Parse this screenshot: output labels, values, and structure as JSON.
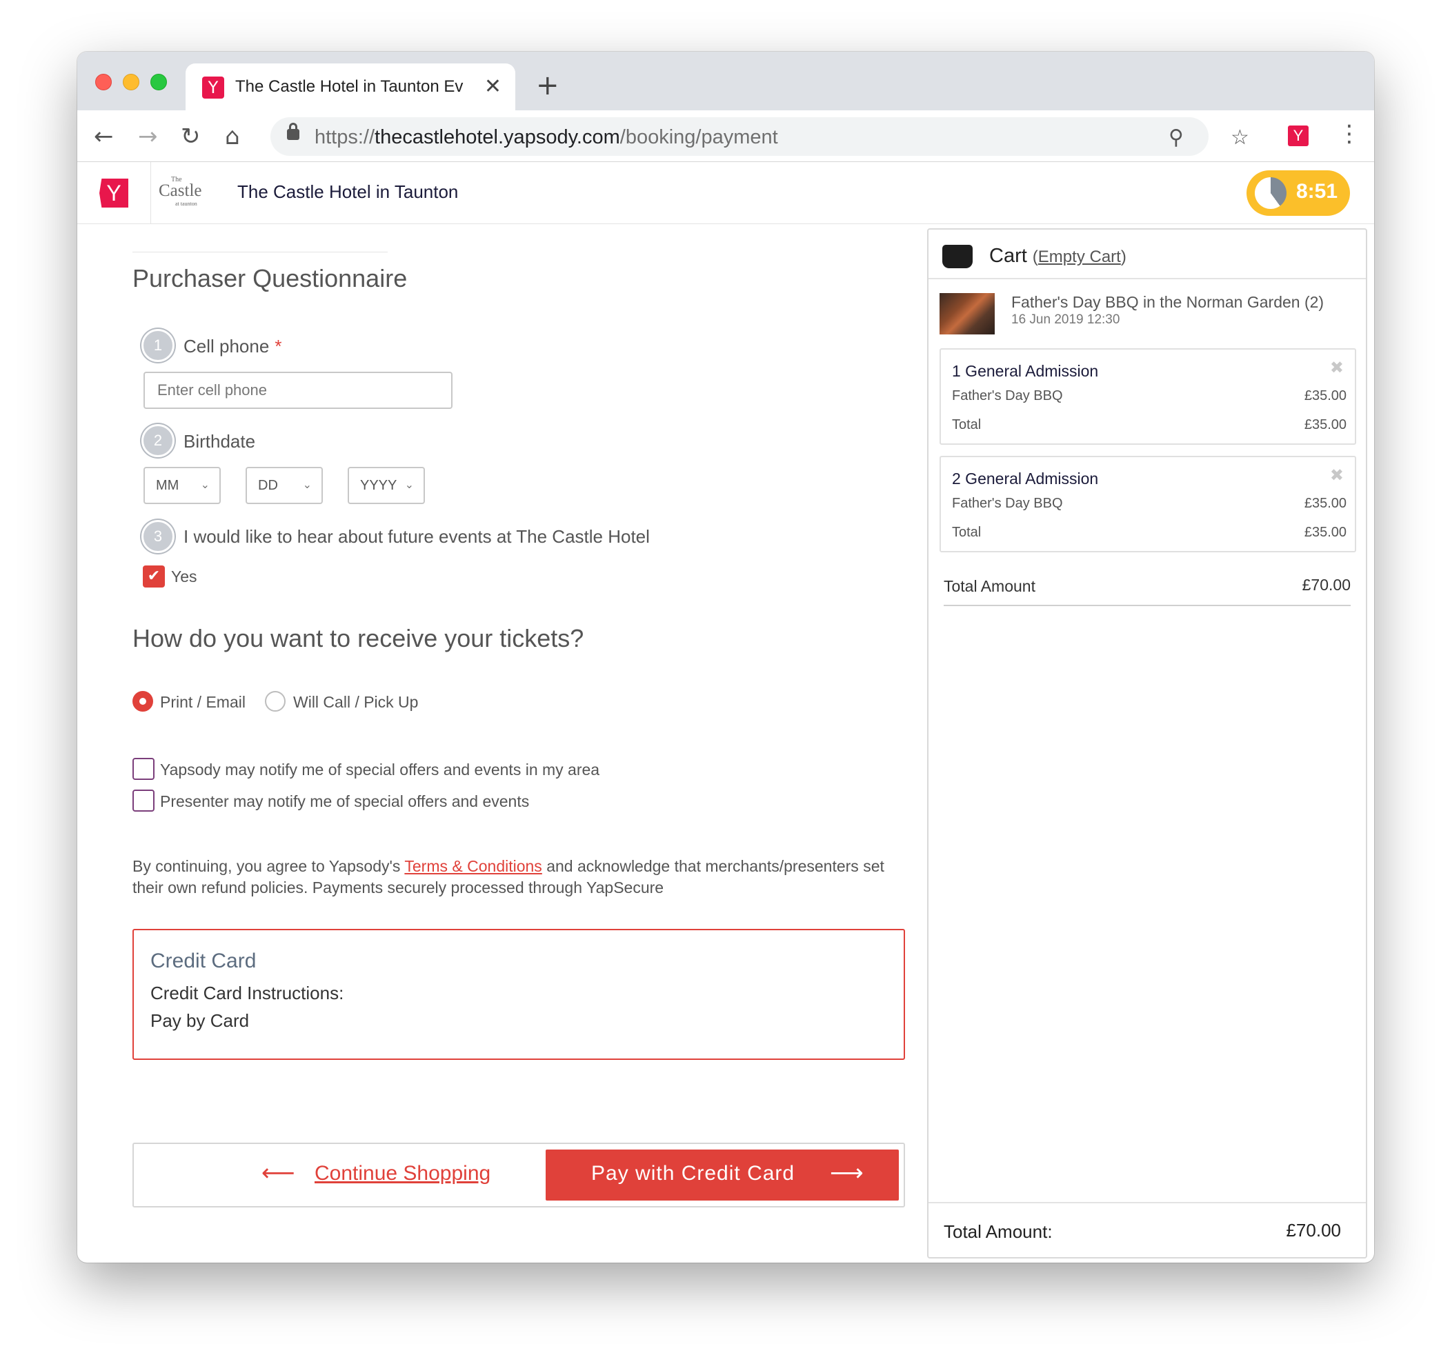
{
  "browser": {
    "tab_title": "The Castle Hotel in Taunton Ev",
    "tab_close": "✕",
    "new_tab": "+",
    "url_scheme": "https://",
    "url_host": "thecastlehotel.yapsody.com",
    "url_path": "/booking/payment",
    "back_icon": "←",
    "forward_icon": "→",
    "reload_icon": "↻",
    "home_icon": "⌂",
    "zoom_icon": "⚲",
    "star_icon": "☆",
    "menu_icon": "⋮",
    "ext_letter": "Y"
  },
  "header": {
    "brand_letter": "Y",
    "castle_small": "The",
    "castle_main": "Castle",
    "castle_sub": "at taunton",
    "venue_name": "The Castle Hotel in Taunton",
    "timer": "8:51",
    "timer_remaining_fraction": 0.6
  },
  "questionnaire": {
    "title": "Purchaser Questionnaire",
    "q1_num": "1",
    "q1_label": "Cell phone",
    "q1_required": "*",
    "q1_placeholder": "Enter cell phone",
    "q2_num": "2",
    "q2_label": "Birthdate",
    "month": "MM",
    "day": "DD",
    "year": "YYYY",
    "chevron": "⌄",
    "q3_num": "3",
    "q3_label": "I would like to hear about future events at The Castle Hotel",
    "q3_check": "✔",
    "q3_option": "Yes"
  },
  "delivery": {
    "title": "How do you want to receive your tickets?",
    "option1": "Print / Email",
    "option2": "Will Call / Pick Up",
    "selected": "Print / Email"
  },
  "consents": {
    "yapsody": "Yapsody may notify me of special offers and events in my area",
    "presenter": "Presenter may notify me of special offers and events"
  },
  "terms": {
    "before": "By continuing, you agree to Yapsody's ",
    "link": "Terms & Conditions",
    "after": " and acknowledge that merchants/presenters set their own refund policies. Payments securely processed through YapSecure"
  },
  "payment": {
    "title": "Credit Card",
    "instructions_label": "Credit Card Instructions:",
    "instructions": "Pay by Card"
  },
  "footer": {
    "back_arrow": "⟵",
    "continue_label": "Continue Shopping",
    "pay_label": "Pay with Credit Card",
    "pay_arrow": "⟶"
  },
  "cart": {
    "title": "Cart",
    "empty_open": "(",
    "empty_label": "Empty Cart",
    "empty_close": ")",
    "event_name": "Father's Day BBQ in the Norman Garden (2)",
    "event_date": "16 Jun 2019 12:30",
    "items": [
      {
        "title": "1 General Admission",
        "remove": "✖",
        "desc": "Father's Day BBQ",
        "price": "£35.00",
        "total_label": "Total",
        "total": "£35.00"
      },
      {
        "title": "2 General Admission",
        "remove": "✖",
        "desc": "Father's Day BBQ",
        "price": "£35.00",
        "total_label": "Total",
        "total": "£35.00"
      }
    ],
    "total_label": "Total Amount",
    "total": "£70.00",
    "footer_total_label": "Total Amount:",
    "footer_total": "£70.00"
  }
}
